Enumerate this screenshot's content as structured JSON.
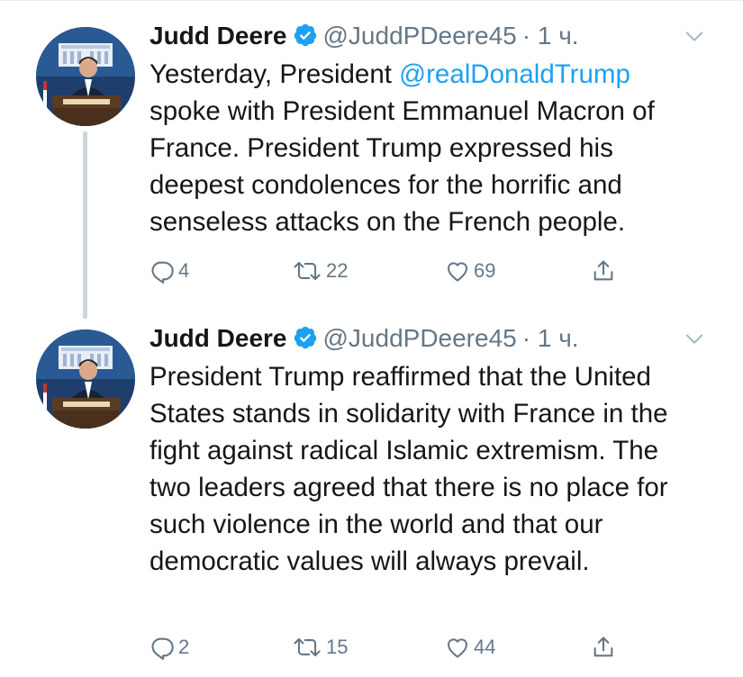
{
  "tweets": [
    {
      "author": {
        "name": "Judd Deere",
        "handle": "@JuddPDeere45",
        "verified": true
      },
      "time": "· 1 ч.",
      "text_before": "Yesterday, President ",
      "mention": "@realDonaldTrump",
      "text_after": " spoke with President Emmanuel Macron of France. President Trump expressed his deepest condolences for the horrific and senseless attacks on the French people.",
      "replies": "4",
      "retweets": "22",
      "likes": "69"
    },
    {
      "author": {
        "name": "Judd Deere",
        "handle": "@JuddPDeere45",
        "verified": true
      },
      "time": "· 1 ч.",
      "text": "President Trump reaffirmed that the United States stands in solidarity with France in the fight against radical Islamic extremism. The two leaders agreed that there is no place for such violence in the world and that our democratic values will always prevail.",
      "replies": "2",
      "retweets": "15",
      "likes": "44"
    }
  ],
  "colors": {
    "accent": "#1da1f2",
    "muted": "#657786",
    "text": "#14171a",
    "thread": "#ccd6dd"
  },
  "icons": [
    "verified-badge-icon",
    "caret-down-icon",
    "reply-icon",
    "retweet-icon",
    "like-icon",
    "share-icon"
  ]
}
